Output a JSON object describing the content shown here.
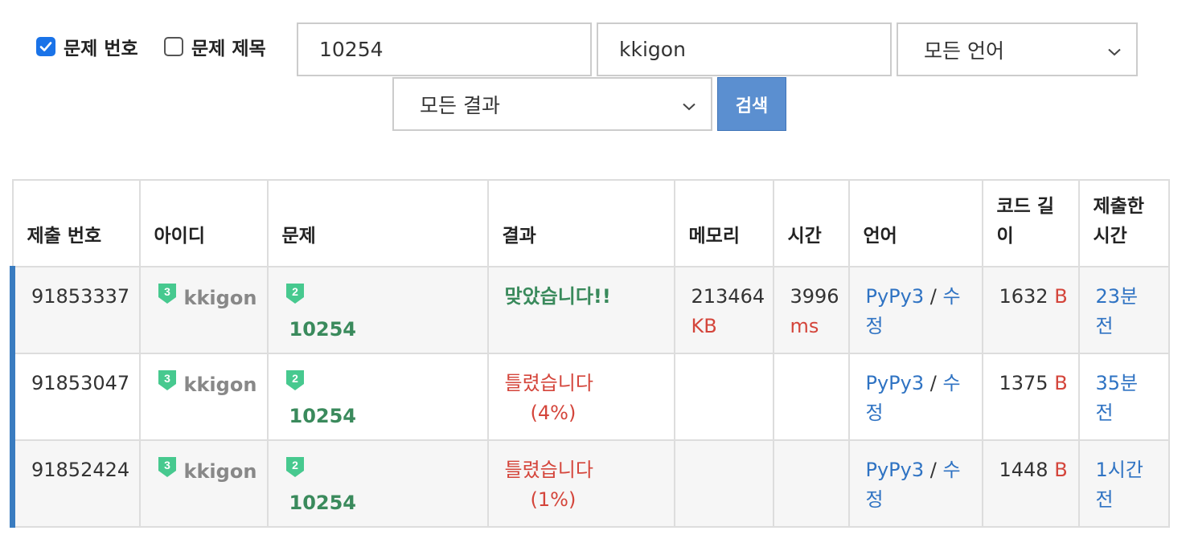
{
  "filters": {
    "problem_number_label": "문제 번호",
    "problem_number_checked": true,
    "problem_title_label": "문제 제목",
    "problem_title_checked": false,
    "problem_input": "10254",
    "user_input": "kkigon",
    "language_select": "모든 언어",
    "result_select": "모든 결과",
    "search_button": "검색"
  },
  "table": {
    "headers": {
      "id": "제출 번호",
      "user": "아이디",
      "problem": "문제",
      "result": "결과",
      "memory": "메모리",
      "time": "시간",
      "language": "언어",
      "code_length": "코드 길이",
      "submitted": "제출한 시간"
    },
    "rows": [
      {
        "id": "91853337",
        "user": "kkigon",
        "user_tier": "3",
        "problem": "10254",
        "problem_tier": "2",
        "result": "맞았습니다!!",
        "result_pct": "",
        "memory": "213464",
        "memory_unit": "KB",
        "time": "3996",
        "time_unit": "ms",
        "language": "PyPy3",
        "edit": "수정",
        "code_length": "1632",
        "code_unit": "B",
        "submitted": "23분 전"
      },
      {
        "id": "91853047",
        "user": "kkigon",
        "user_tier": "3",
        "problem": "10254",
        "problem_tier": "2",
        "result": "틀렸습니다",
        "result_pct": "(4%)",
        "memory": "",
        "memory_unit": "",
        "time": "",
        "time_unit": "",
        "language": "PyPy3",
        "edit": "수정",
        "code_length": "1375",
        "code_unit": "B",
        "submitted": "35분 전"
      },
      {
        "id": "91852424",
        "user": "kkigon",
        "user_tier": "3",
        "problem": "10254",
        "problem_tier": "2",
        "result": "틀렸습니다",
        "result_pct": "(1%)",
        "memory": "",
        "memory_unit": "",
        "time": "",
        "time_unit": "",
        "language": "PyPy3",
        "edit": "수정",
        "code_length": "1448",
        "code_unit": "B",
        "submitted": "1시간 전"
      }
    ]
  },
  "colors": {
    "accepted": "#3a8a5c",
    "wrong": "#d4453b",
    "link": "#2f73c3",
    "tier": "#47c98f",
    "row_marker": "#3a7cc0",
    "button": "#5b8fd0"
  },
  "icons": {
    "checkbox_checked": "checkmark-icon",
    "select_caret": "chevron-down-icon",
    "tier_badge": "tier-shield-icon"
  }
}
